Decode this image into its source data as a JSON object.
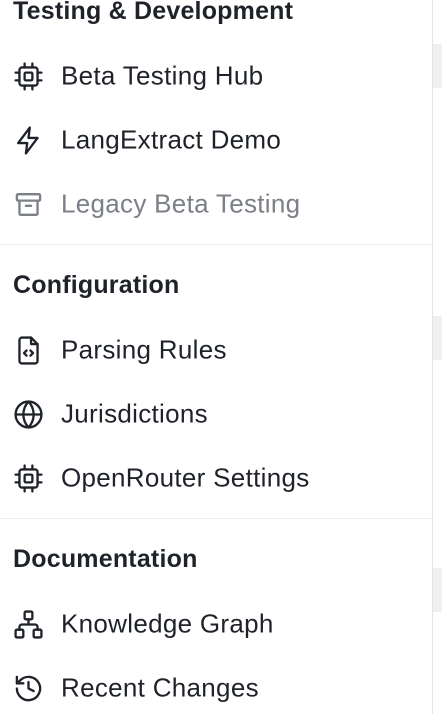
{
  "colors": {
    "text": "#1f2329",
    "muted": "#7b7f86",
    "divider": "#ececec"
  },
  "sections": [
    {
      "title": "Testing & Development",
      "items": [
        {
          "label": "Beta Testing Hub",
          "icon": "cpu-icon"
        },
        {
          "label": "LangExtract Demo",
          "icon": "lightning-icon"
        },
        {
          "label": "Legacy Beta Testing",
          "icon": "archive-icon",
          "muted": true
        }
      ]
    },
    {
      "title": "Configuration",
      "items": [
        {
          "label": "Parsing Rules",
          "icon": "file-code-icon"
        },
        {
          "label": "Jurisdictions",
          "icon": "globe-icon"
        },
        {
          "label": "OpenRouter Settings",
          "icon": "cpu-icon"
        }
      ]
    },
    {
      "title": "Documentation",
      "items": [
        {
          "label": "Knowledge Graph",
          "icon": "network-icon"
        },
        {
          "label": "Recent Changes",
          "icon": "history-icon"
        }
      ]
    }
  ]
}
